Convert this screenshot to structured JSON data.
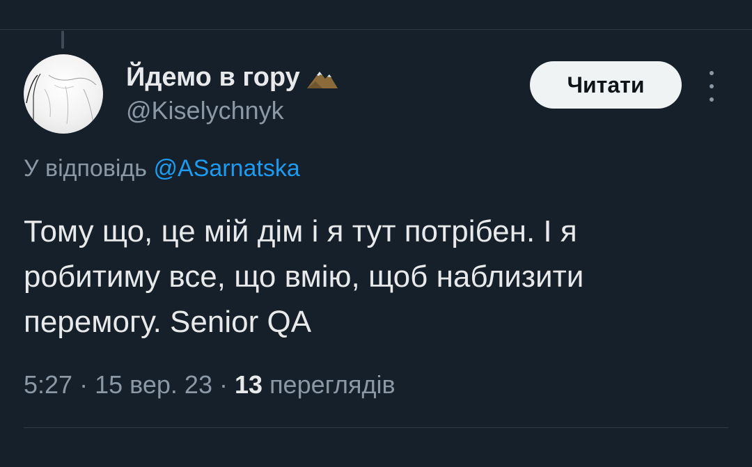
{
  "tweet": {
    "author": {
      "display_name": "Йдемо в гору",
      "name_emoji_icon": "mountain-icon",
      "handle": "@Kiselychnyk",
      "avatar_icon": "avatar-photo"
    },
    "follow_label": "Читати",
    "more_icon": "more-vertical-icon",
    "reply_prefix": "У відповідь",
    "reply_to": "@ASarnatska",
    "text": "Тому що, це мій дім і я тут потрібен. І я робитиму все, що вмію, щоб наблизити перемогу. Senior QA",
    "time": "5:27",
    "date": "15 вер. 23",
    "separator": "·",
    "views_count": "13",
    "views_label": "переглядів"
  },
  "colors": {
    "background": "#15202b",
    "text_primary": "#e7e9ea",
    "text_secondary": "#8b98a5",
    "link": "#1d9bf0",
    "button_bg": "#eff3f4"
  }
}
